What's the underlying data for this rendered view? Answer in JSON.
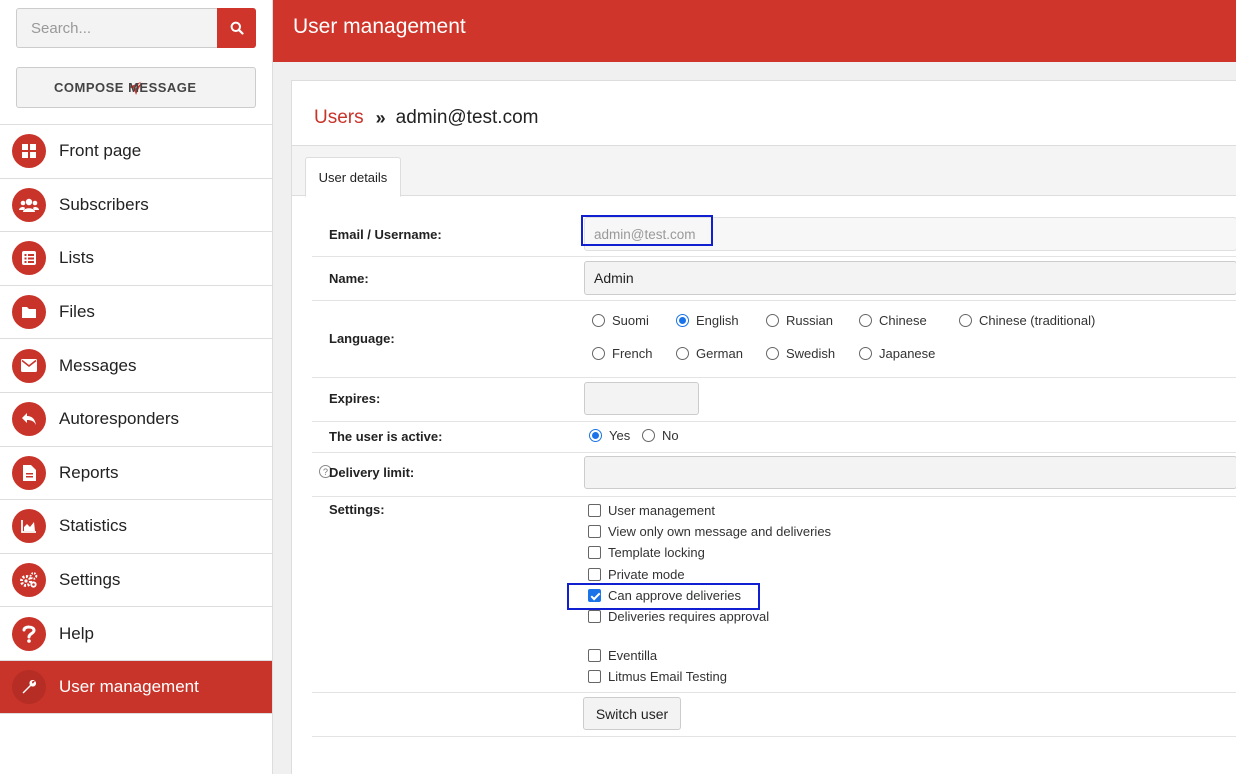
{
  "sidebar": {
    "search_placeholder": "Search...",
    "compose_label": "COMPOSE MESSAGE",
    "items": [
      {
        "label": "Front page",
        "icon": "grid-icon"
      },
      {
        "label": "Subscribers",
        "icon": "users-icon"
      },
      {
        "label": "Lists",
        "icon": "list-icon"
      },
      {
        "label": "Files",
        "icon": "folder-icon"
      },
      {
        "label": "Messages",
        "icon": "envelope-icon"
      },
      {
        "label": "Autoresponders",
        "icon": "reply-icon"
      },
      {
        "label": "Reports",
        "icon": "document-icon"
      },
      {
        "label": "Statistics",
        "icon": "area-chart-icon"
      },
      {
        "label": "Settings",
        "icon": "gears-icon"
      },
      {
        "label": "Help",
        "icon": "question-icon"
      },
      {
        "label": "User management",
        "icon": "wrench-icon",
        "active": true
      }
    ]
  },
  "header": {
    "title": "User management"
  },
  "breadcrumb": {
    "link": "Users",
    "separator": "»",
    "current": "admin@test.com"
  },
  "tabs": [
    {
      "label": "User details",
      "active": true
    }
  ],
  "form": {
    "email": {
      "label": "Email / Username:",
      "value": "admin@test.com"
    },
    "name": {
      "label": "Name:",
      "value": "Admin"
    },
    "language": {
      "label": "Language:",
      "options": [
        "Suomi",
        "English",
        "Russian",
        "Chinese",
        "Chinese (traditional)",
        "French",
        "German",
        "Swedish",
        "Japanese"
      ],
      "selected": "English"
    },
    "expires": {
      "label": "Expires:",
      "value": ""
    },
    "active": {
      "label": "The user is active:",
      "yes": "Yes",
      "no": "No",
      "selected": "Yes"
    },
    "delivery_limit": {
      "label": "Delivery limit:",
      "value": ""
    },
    "settings": {
      "label": "Settings:",
      "options": [
        {
          "label": "User management",
          "checked": false
        },
        {
          "label": "View only own message and deliveries",
          "checked": false
        },
        {
          "label": "Template locking",
          "checked": false
        },
        {
          "label": "Private mode",
          "checked": false
        },
        {
          "label": "Can approve deliveries",
          "checked": true
        },
        {
          "label": "Deliveries requires approval",
          "checked": false
        },
        {
          "label": "Eventilla",
          "checked": false
        },
        {
          "label": "Litmus Email Testing",
          "checked": false
        }
      ]
    },
    "switch_user_label": "Switch user"
  },
  "colors": {
    "brand": "#cf352a",
    "highlight": "#1020d0",
    "accent": "#1a73e8"
  }
}
